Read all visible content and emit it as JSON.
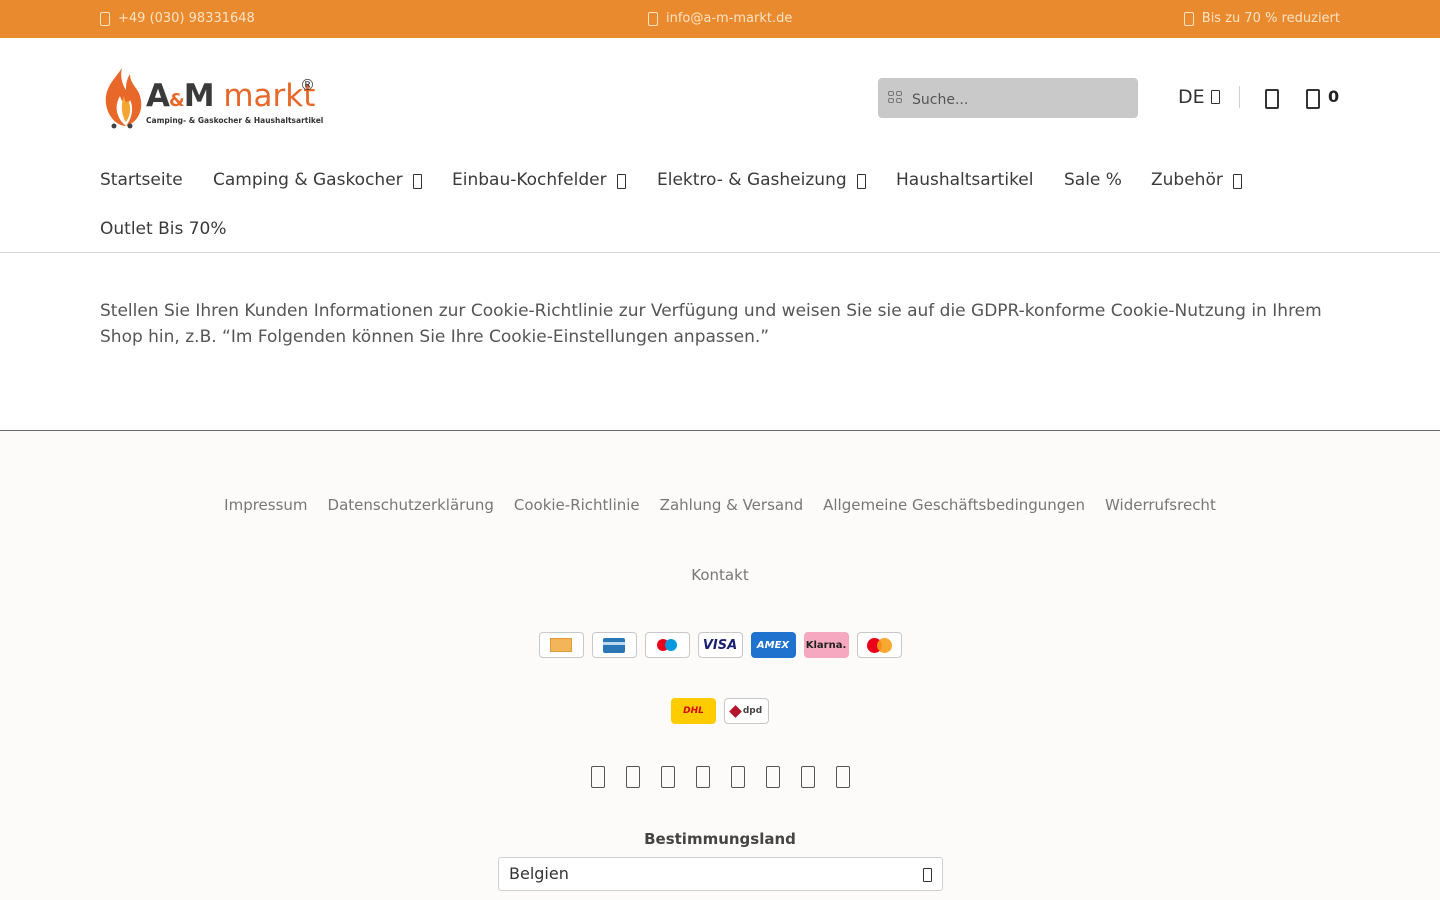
{
  "topbar": {
    "phone": "+49 (030) 98331648",
    "email": "info@a-m-markt.de",
    "promo": "Bis zu 70 % reduziert"
  },
  "logo": {
    "brand_a": "A",
    "brand_amp": "&",
    "brand_m": "M",
    "brand_markt": "markt",
    "reg": "®",
    "tagline": "Camping- & Gaskocher & Haushaltsartikel"
  },
  "search": {
    "placeholder": "Suche..."
  },
  "header": {
    "language": "DE",
    "cart_count": "0"
  },
  "nav": {
    "items": [
      {
        "label": "Startseite"
      },
      {
        "label": "Camping & Gaskocher"
      },
      {
        "label": "Einbau-Kochfelder"
      },
      {
        "label": "Elektro- & Gasheizung"
      },
      {
        "label": "Haushaltsartikel"
      },
      {
        "label": "Sale %"
      },
      {
        "label": "Zubehör"
      },
      {
        "label": "Outlet Bis 70%"
      }
    ]
  },
  "content": {
    "text": "Stellen Sie Ihren Kunden Informationen zur Cookie-Richtlinie zur Verfügung und weisen Sie sie auf die GDPR-konforme Cookie-Nutzung in Ihrem Shop hin, z.B. “Im Folgenden können Sie Ihre Cookie-Einstellungen anpassen.”"
  },
  "footer": {
    "links": [
      "Impressum",
      "Datenschutzerklärung",
      "Cookie-Richtlinie",
      "Zahlung & Versand",
      "Allgemeine Geschäftsbedingungen",
      "Widerrufsrecht"
    ],
    "contact": "Kontakt",
    "payments": {
      "visa": "VISA",
      "amex": "AMEX",
      "klarna": "Klarna."
    },
    "shipping": {
      "dhl": "DHL",
      "dpd": "dpd"
    },
    "country_label": "Bestimmungsland",
    "country_value": "Belgien"
  },
  "colors": {
    "topbar": "#ea8a2e",
    "brand_orange": "#e8682a"
  }
}
